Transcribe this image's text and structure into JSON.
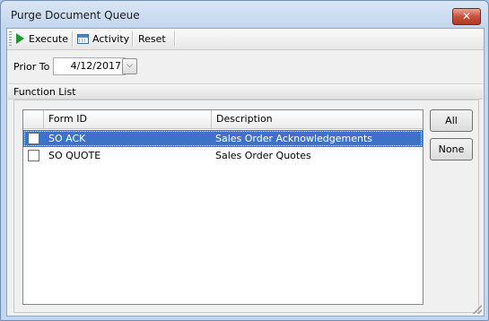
{
  "window": {
    "title": "Purge Document Queue",
    "close_label": "✕"
  },
  "toolbar": {
    "execute_label": "Execute",
    "activity_label": "Activity",
    "reset_label": "Reset"
  },
  "filter": {
    "prior_to_label": "Prior To",
    "prior_to_value": "4/12/2017",
    "dropdown_glyph": "⌵"
  },
  "function_list": {
    "title": "Function List",
    "columns": [
      "Form ID",
      "Description"
    ],
    "rows": [
      {
        "form_id": "SO ACK",
        "description": "Sales Order Acknowledgements",
        "checked": false,
        "selected": true
      },
      {
        "form_id": "SO QUOTE",
        "description": "Sales  Order Quotes",
        "checked": false,
        "selected": false
      }
    ],
    "all_label": "All",
    "none_label": "None"
  },
  "colors": {
    "selection": "#3d73c6",
    "execute_icon": "#1f9a2a"
  },
  "icons": [
    "play-icon",
    "calendar-grid-icon",
    "close-icon",
    "chevron-down-icon"
  ]
}
